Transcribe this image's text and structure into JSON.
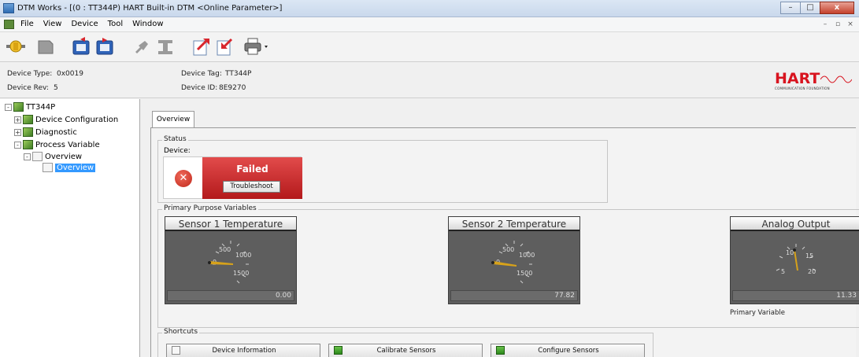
{
  "window": {
    "title": "DTM Works - [(0 : TT344P) HART Built-in DTM <Online Parameter>]",
    "min_icon": "minimize-icon",
    "max_icon": "maximize-icon",
    "close_icon": "close-icon"
  },
  "menubar": {
    "items": [
      "File",
      "View",
      "Device",
      "Tool",
      "Window"
    ],
    "mdi_min": "–",
    "mdi_max": "▫",
    "mdi_close": "×"
  },
  "device_header": {
    "type_label": "Device Type:",
    "type_value": "0x0019",
    "rev_label": "Device Rev:",
    "rev_value": "5",
    "tag_label": "Device Tag:",
    "tag_value": "TT344P",
    "id_label": "Device ID:",
    "id_value": "8E9270",
    "logo_text": "HART",
    "logo_sub": "COMMUNICATION FOUNDATION"
  },
  "tree": {
    "root": "TT344P",
    "device_configuration": "Device Configuration",
    "diagnostic": "Diagnostic",
    "process_variable": "Process Variable",
    "overview_folder": "Overview",
    "overview_page": "Overview"
  },
  "tabs": {
    "overview": "Overview"
  },
  "status": {
    "legend": "Status",
    "device_label": "Device:",
    "state": "Failed",
    "troubleshoot": "Troubleshoot",
    "color": "#c62828"
  },
  "ppv": {
    "legend": "Primary Purpose Variables",
    "primary_variable_label": "Primary Variable",
    "gauges": [
      {
        "title": "Sensor 1 Temperature",
        "value": "0.00",
        "ticks": [
          "0",
          "500",
          "1000",
          "1500"
        ]
      },
      {
        "title": "Sensor 2 Temperature",
        "value": "77.82",
        "ticks": [
          "0",
          "500",
          "1000",
          "1500"
        ]
      },
      {
        "title": "Analog Output",
        "value": "11.33",
        "ticks": [
          "5",
          "10",
          "15",
          "20"
        ]
      }
    ]
  },
  "shortcuts": {
    "legend": "Shortcuts",
    "device_information": "Device Information",
    "calibrate_sensors": "Calibrate Sensors",
    "configure_sensors": "Configure Sensors"
  }
}
